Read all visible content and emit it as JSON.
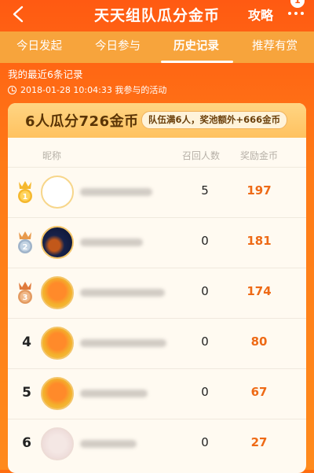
{
  "header": {
    "title": "天天组队瓜分金币",
    "back_icon": "chevron-left-icon",
    "strategy_label": "攻略",
    "more_icon": "more-dots-icon",
    "badge": "1"
  },
  "tabs": [
    {
      "label": "今日发起",
      "active": false
    },
    {
      "label": "今日参与",
      "active": false
    },
    {
      "label": "历史记录",
      "active": true
    },
    {
      "label": "推荐有赏",
      "active": false
    }
  ],
  "info": {
    "recent": "我的最近6条记录",
    "timeline": "2018-01-28 10:04:33 我参与的活动",
    "clock_icon": "clock-icon"
  },
  "card": {
    "title": "6人瓜分726金币",
    "note": "队伍满6人，奖池额外+666金币",
    "col_name": "昵称",
    "col_recall": "召回人数",
    "col_reward": "奖励金币"
  },
  "rows": [
    {
      "rank": "1",
      "recall": "5",
      "reward": "197",
      "medal": "gold",
      "avatar": "blank-circle"
    },
    {
      "rank": "2",
      "recall": "0",
      "reward": "181",
      "medal": "silver",
      "avatar": "dark-photo"
    },
    {
      "rank": "3",
      "recall": "0",
      "reward": "174",
      "medal": "bronze",
      "avatar": "orange-character"
    },
    {
      "rank": "4",
      "recall": "0",
      "reward": "80",
      "medal": "",
      "avatar": "orange-character"
    },
    {
      "rank": "5",
      "recall": "0",
      "reward": "67",
      "medal": "",
      "avatar": "orange-character"
    },
    {
      "rank": "6",
      "recall": "0",
      "reward": "27",
      "medal": "",
      "avatar": "blurred-photo"
    }
  ],
  "colors": {
    "accent": "#ff5a12",
    "reward": "#ee6a16",
    "gold": "#f5b82e",
    "silver": "#9fb3c9",
    "bronze": "#e39a60"
  }
}
